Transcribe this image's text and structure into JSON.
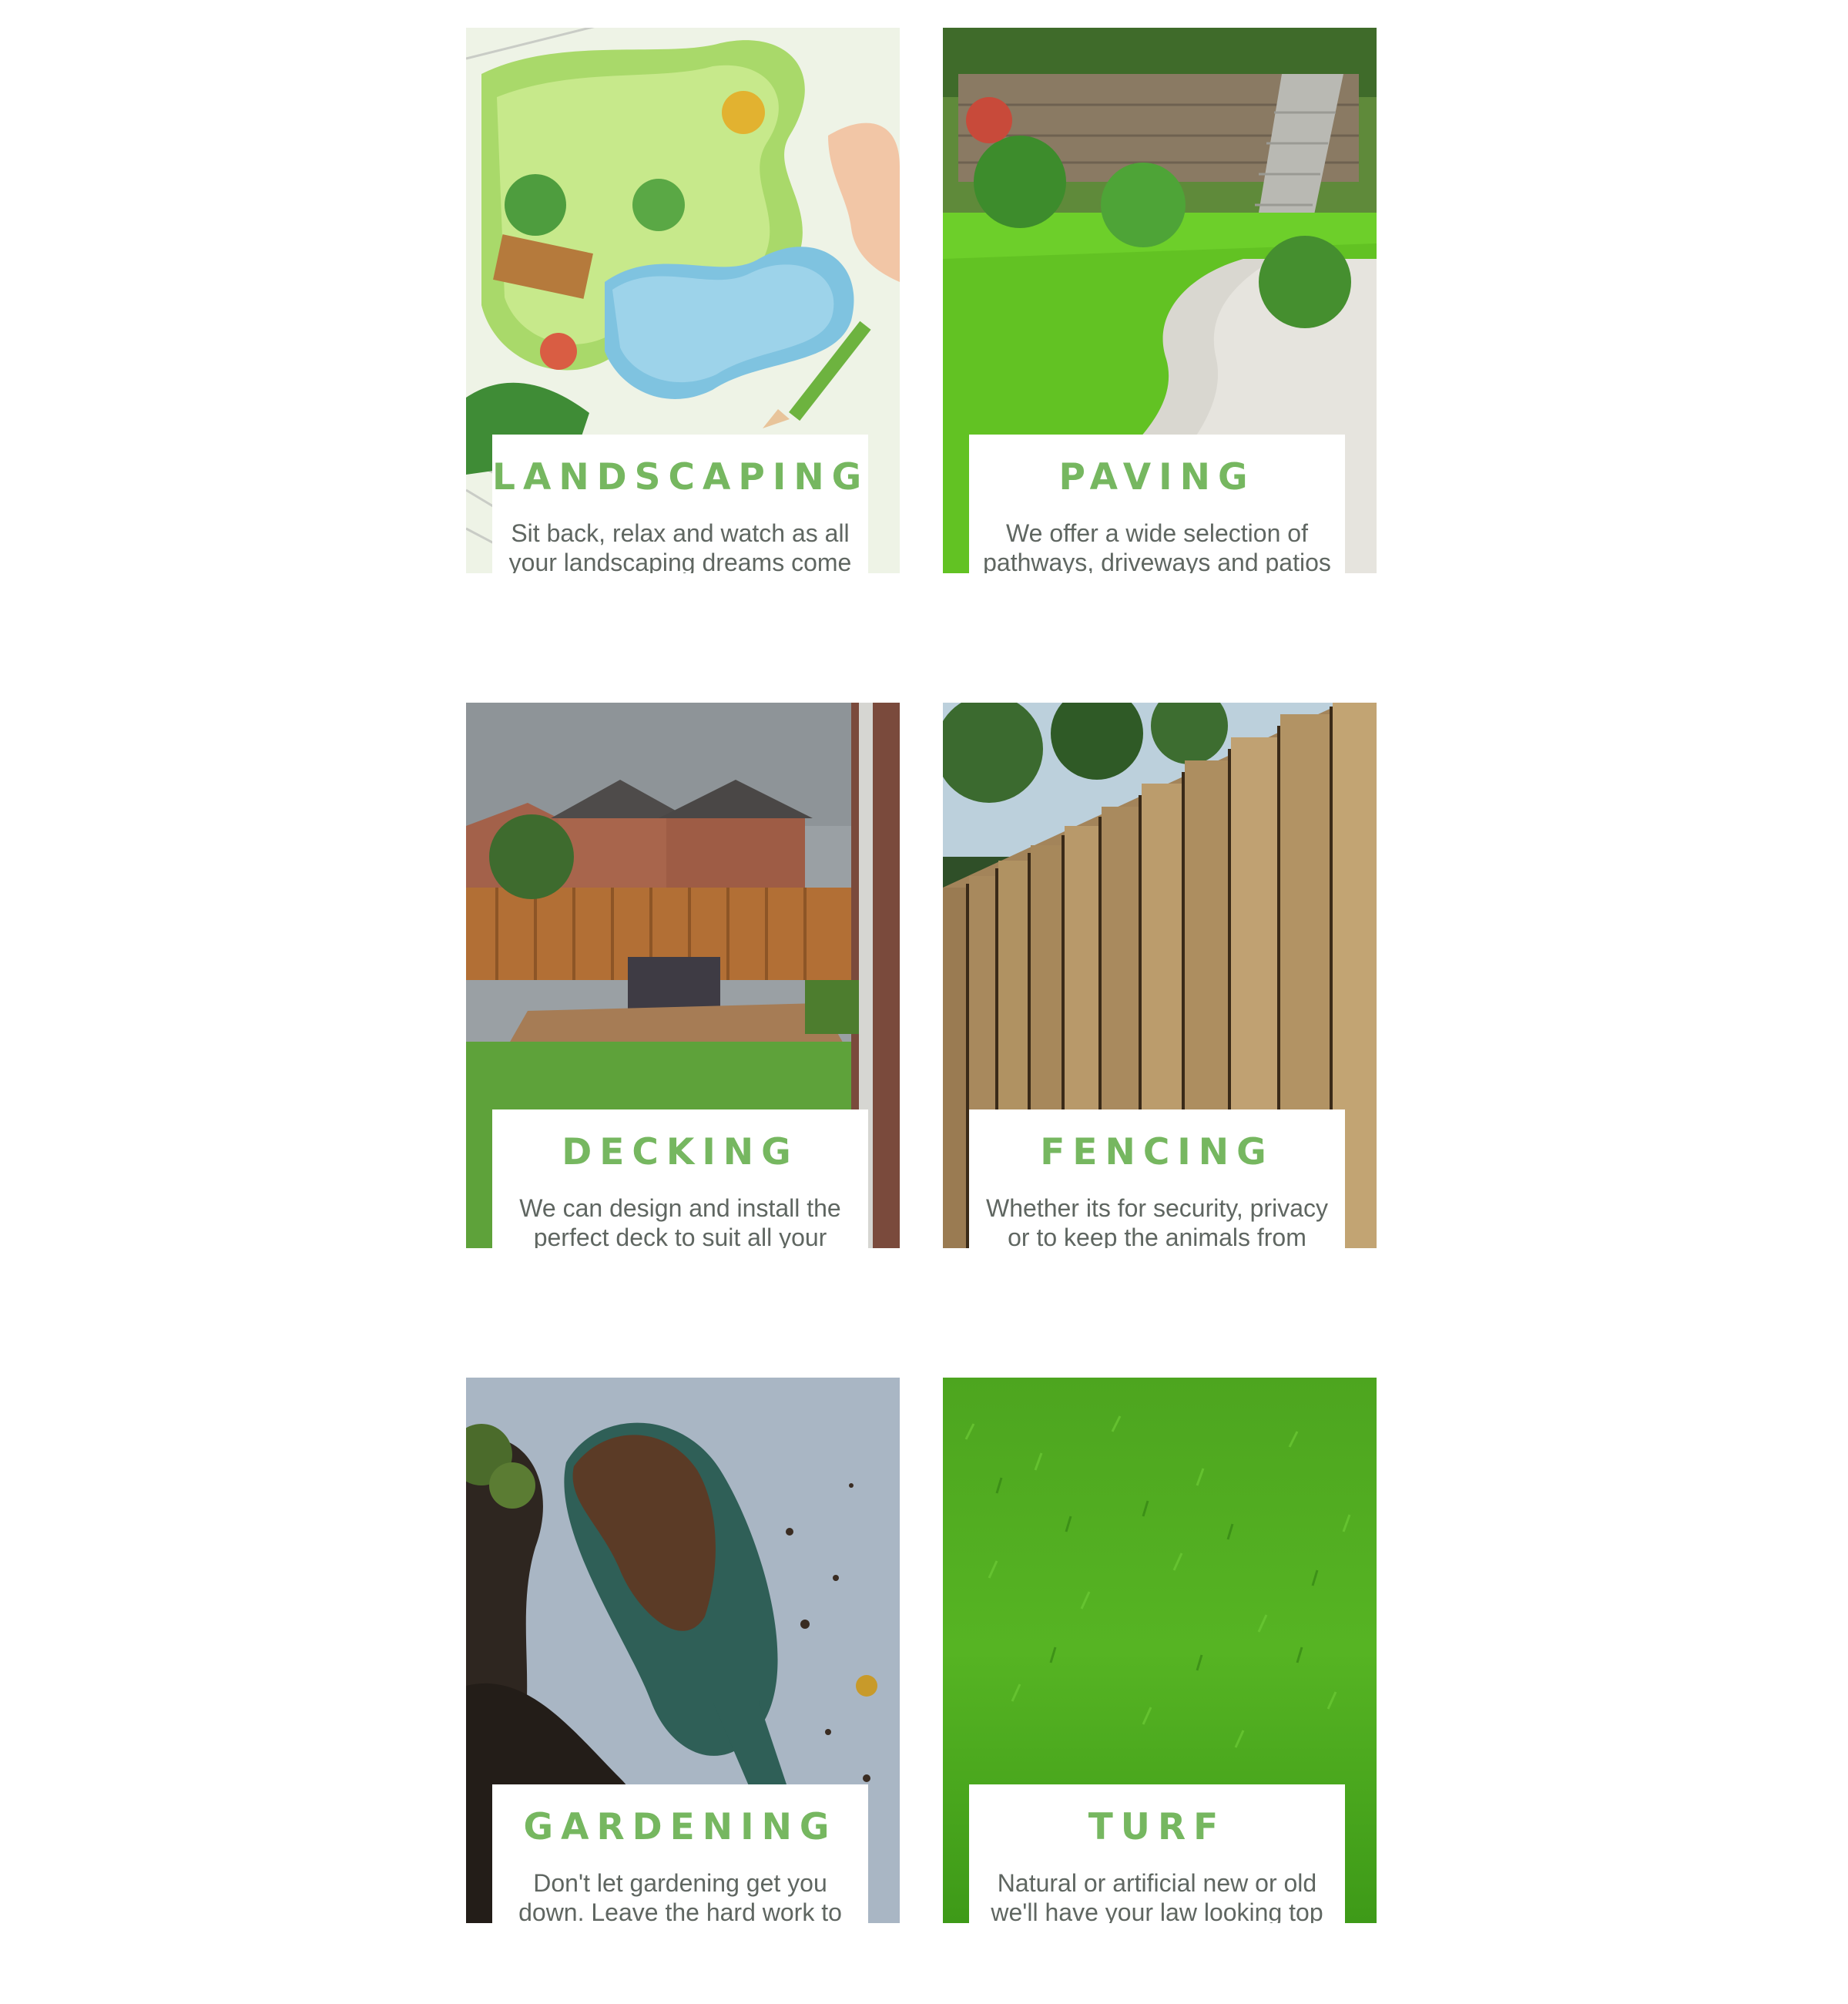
{
  "services": [
    {
      "image": "landscape-plan-drawing",
      "title": "LANDSCAPING",
      "description": "Sit back, relax and watch as all your landscaping dreams come to life"
    },
    {
      "image": "paved-garden-path",
      "title": "PAVING",
      "description": "We offer a wide selection of pathways, driveways and patios"
    },
    {
      "image": "garden-decking",
      "title": "DECKING",
      "description": "We can design and install the perfect deck to suit all your needs"
    },
    {
      "image": "wooden-fence",
      "title": "FENCING",
      "description": "Whether its for security, privacy or to keep the animals from straying we can help"
    },
    {
      "image": "soil-trowel",
      "title": "GARDENING",
      "description": "Don't let gardening get you down. Leave the hard work to us"
    },
    {
      "image": "green-turf",
      "title": "TURF",
      "description": "Natural or artificial new or old we'll have your law looking top notch"
    }
  ],
  "colors": {
    "title": "#76b760",
    "text": "#5f6661",
    "panel": "#ffffff"
  }
}
